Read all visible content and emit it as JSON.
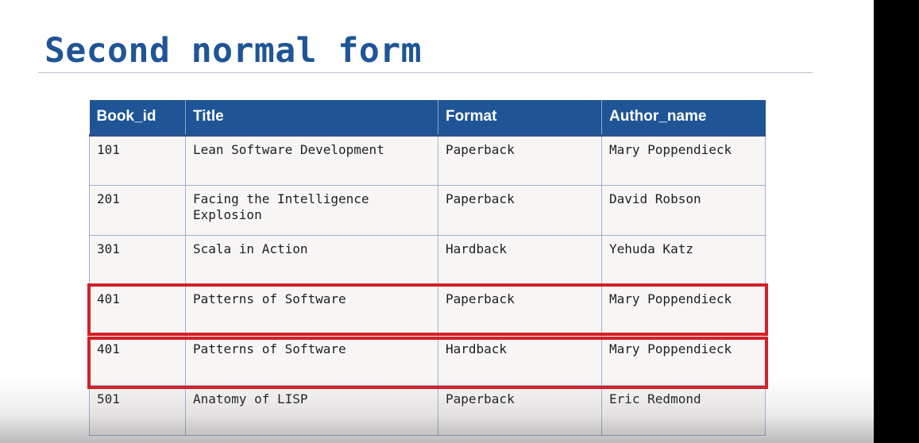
{
  "slide": {
    "title": "Second normal form"
  },
  "table": {
    "headers": [
      "Book_id",
      "Title",
      "Format",
      "Author_name"
    ],
    "rows": [
      [
        "101",
        "Lean Software Development",
        "Paperback",
        "Mary Poppendieck"
      ],
      [
        "201",
        "Facing the Intelligence Explosion",
        "Paperback",
        "David Robson"
      ],
      [
        "301",
        "Scala in Action",
        "Hardback",
        "Yehuda Katz"
      ],
      [
        "401",
        "Patterns of Software",
        "Paperback",
        "Mary Poppendieck"
      ],
      [
        "401",
        "Patterns of Software",
        "Hardback",
        "Mary Poppendieck"
      ],
      [
        "501",
        "Anatomy of LISP",
        "Paperback",
        "Eric Redmond"
      ]
    ],
    "highlighted_rows": [
      3,
      4
    ]
  },
  "colors": {
    "title": "#1f5596",
    "header_background": "#1f5596",
    "highlight": "#d42027",
    "cell_background": "#f8f5f5"
  }
}
